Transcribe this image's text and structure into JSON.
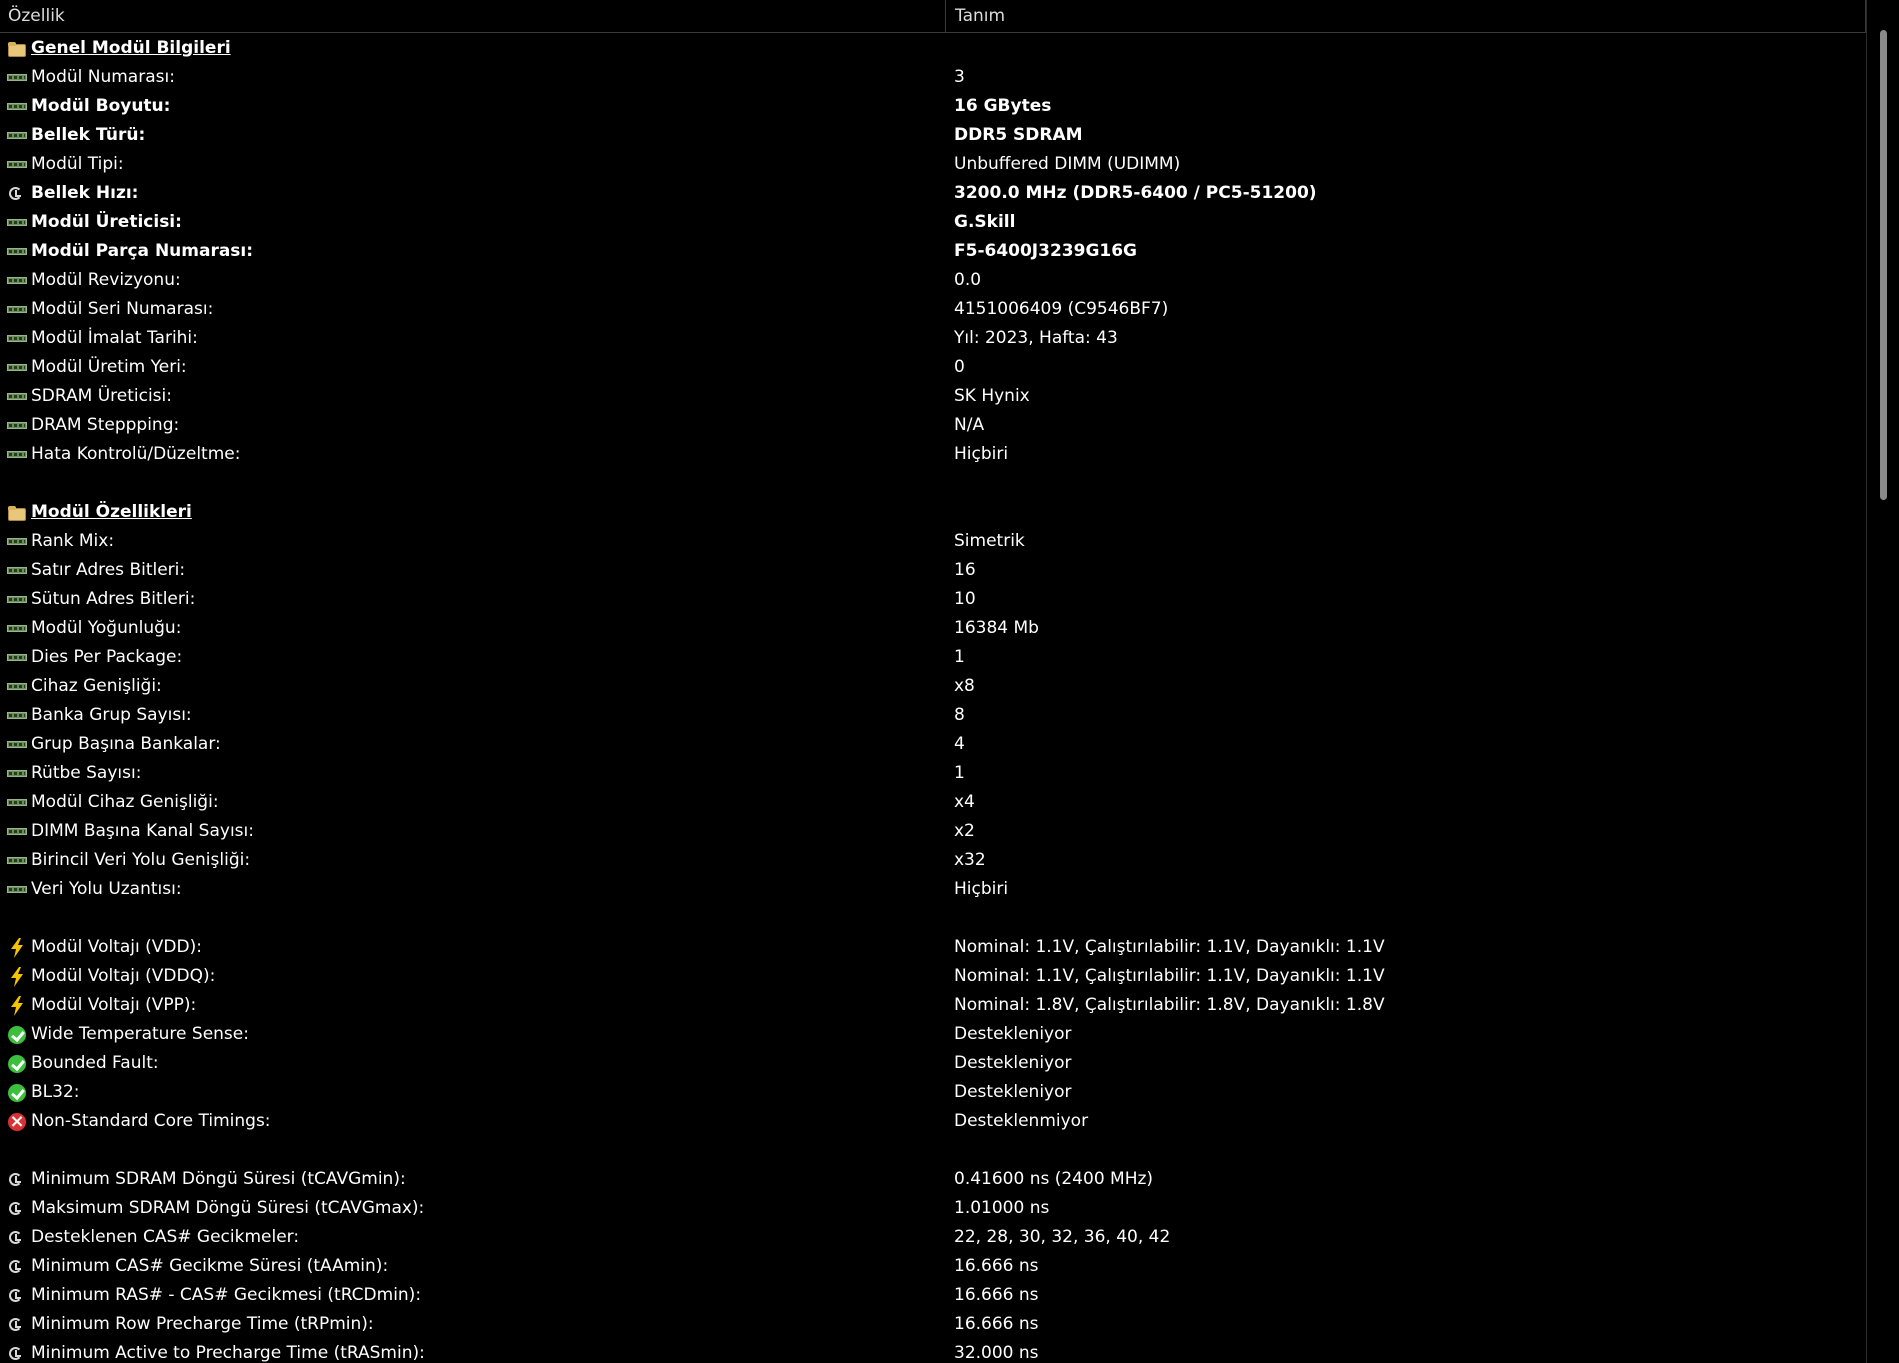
{
  "header": {
    "col1": "Özellik",
    "col2": "Tanım"
  },
  "rows": [
    {
      "type": "section",
      "icon": "folder-icon",
      "label": "Genel Modül Bilgileri",
      "value": ""
    },
    {
      "type": "item",
      "icon": "ram-icon",
      "label": "Modül Numarası:",
      "value": "3",
      "bold": false
    },
    {
      "type": "item",
      "icon": "ram-icon",
      "label": "Modül Boyutu:",
      "value": "16 GBytes",
      "bold": true
    },
    {
      "type": "item",
      "icon": "ram-icon",
      "label": "Bellek Türü:",
      "value": "DDR5 SDRAM",
      "bold": true
    },
    {
      "type": "item",
      "icon": "ram-icon",
      "label": "Modül Tipi:",
      "value": "Unbuffered DIMM (UDIMM)",
      "bold": false
    },
    {
      "type": "item",
      "icon": "clock-icon",
      "label": "Bellek Hızı:",
      "value": "3200.0 MHz (DDR5-6400 / PC5-51200)",
      "bold": true
    },
    {
      "type": "item",
      "icon": "ram-icon",
      "label": "Modül Üreticisi:",
      "value": "G.Skill",
      "bold": true
    },
    {
      "type": "item",
      "icon": "ram-icon",
      "label": "Modül Parça Numarası:",
      "value": "F5-6400J3239G16G",
      "bold": true
    },
    {
      "type": "item",
      "icon": "ram-icon",
      "label": "Modül Revizyonu:",
      "value": "0.0",
      "bold": false
    },
    {
      "type": "item",
      "icon": "ram-icon",
      "label": "Modül Seri Numarası:",
      "value": "4151006409 (C9546BF7)",
      "bold": false
    },
    {
      "type": "item",
      "icon": "ram-icon",
      "label": "Modül İmalat Tarihi:",
      "value": "Yıl: 2023, Hafta: 43",
      "bold": false
    },
    {
      "type": "item",
      "icon": "ram-icon",
      "label": "Modül Üretim Yeri:",
      "value": "0",
      "bold": false
    },
    {
      "type": "item",
      "icon": "ram-icon",
      "label": "SDRAM Üreticisi:",
      "value": "SK Hynix",
      "bold": false
    },
    {
      "type": "item",
      "icon": "ram-icon",
      "label": "DRAM Steppping:",
      "value": "N/A",
      "bold": false
    },
    {
      "type": "item",
      "icon": "ram-icon",
      "label": "Hata Kontrolü/Düzeltme:",
      "value": "Hiçbiri",
      "bold": false
    },
    {
      "type": "blank"
    },
    {
      "type": "section",
      "icon": "folder-icon",
      "label": "Modül Özellikleri",
      "value": ""
    },
    {
      "type": "item",
      "icon": "ram-icon",
      "label": "Rank Mix:",
      "value": "Simetrik",
      "bold": false
    },
    {
      "type": "item",
      "icon": "ram-icon",
      "label": "Satır Adres Bitleri:",
      "value": "16",
      "bold": false
    },
    {
      "type": "item",
      "icon": "ram-icon",
      "label": "Sütun Adres Bitleri:",
      "value": "10",
      "bold": false
    },
    {
      "type": "item",
      "icon": "ram-icon",
      "label": "Modül Yoğunluğu:",
      "value": "16384 Mb",
      "bold": false
    },
    {
      "type": "item",
      "icon": "ram-icon",
      "label": "Dies Per Package:",
      "value": "1",
      "bold": false
    },
    {
      "type": "item",
      "icon": "ram-icon",
      "label": "Cihaz Genişliği:",
      "value": "x8",
      "bold": false
    },
    {
      "type": "item",
      "icon": "ram-icon",
      "label": "Banka Grup Sayısı:",
      "value": "8",
      "bold": false
    },
    {
      "type": "item",
      "icon": "ram-icon",
      "label": "Grup Başına Bankalar:",
      "value": "4",
      "bold": false
    },
    {
      "type": "item",
      "icon": "ram-icon",
      "label": "Rütbe Sayısı:",
      "value": "1",
      "bold": false
    },
    {
      "type": "item",
      "icon": "ram-icon",
      "label": "Modül Cihaz Genişliği:",
      "value": "x4",
      "bold": false
    },
    {
      "type": "item",
      "icon": "ram-icon",
      "label": "DIMM Başına Kanal Sayısı:",
      "value": "x2",
      "bold": false
    },
    {
      "type": "item",
      "icon": "ram-icon",
      "label": "Birincil Veri Yolu Genişliği:",
      "value": "x32",
      "bold": false
    },
    {
      "type": "item",
      "icon": "ram-icon",
      "label": "Veri Yolu Uzantısı:",
      "value": "Hiçbiri",
      "bold": false
    },
    {
      "type": "blank"
    },
    {
      "type": "item",
      "icon": "bolt-icon",
      "label": "Modül Voltajı (VDD):",
      "value": "Nominal: 1.1V, Çalıştırılabilir: 1.1V, Dayanıklı: 1.1V",
      "bold": false
    },
    {
      "type": "item",
      "icon": "bolt-icon",
      "label": "Modül Voltajı (VDDQ):",
      "value": "Nominal: 1.1V, Çalıştırılabilir: 1.1V, Dayanıklı: 1.1V",
      "bold": false
    },
    {
      "type": "item",
      "icon": "bolt-icon",
      "label": "Modül Voltajı (VPP):",
      "value": "Nominal: 1.8V, Çalıştırılabilir: 1.8V, Dayanıklı: 1.8V",
      "bold": false
    },
    {
      "type": "item",
      "icon": "check-icon",
      "label": "Wide Temperature Sense:",
      "value": "Destekleniyor",
      "bold": false
    },
    {
      "type": "item",
      "icon": "check-icon",
      "label": "Bounded Fault:",
      "value": "Destekleniyor",
      "bold": false
    },
    {
      "type": "item",
      "icon": "check-icon",
      "label": "BL32:",
      "value": "Destekleniyor",
      "bold": false
    },
    {
      "type": "item",
      "icon": "cross-icon",
      "label": "Non-Standard Core Timings:",
      "value": "Desteklenmiyor",
      "bold": false
    },
    {
      "type": "blank"
    },
    {
      "type": "item",
      "icon": "clock-icon",
      "label": "Minimum SDRAM Döngü Süresi (tCAVGmin):",
      "value": "0.41600 ns (2400 MHz)",
      "bold": false
    },
    {
      "type": "item",
      "icon": "clock-icon",
      "label": "Maksimum SDRAM Döngü Süresi (tCAVGmax):",
      "value": "1.01000 ns",
      "bold": false
    },
    {
      "type": "item",
      "icon": "clock-icon",
      "label": "Desteklenen CAS# Gecikmeler:",
      "value": "22, 28, 30, 32, 36, 40, 42",
      "bold": false
    },
    {
      "type": "item",
      "icon": "clock-icon",
      "label": "Minimum CAS# Gecikme Süresi (tAAmin):",
      "value": "16.666 ns",
      "bold": false
    },
    {
      "type": "item",
      "icon": "clock-icon",
      "label": "Minimum RAS# - CAS# Gecikmesi (tRCDmin):",
      "value": "16.666 ns",
      "bold": false
    },
    {
      "type": "item",
      "icon": "clock-icon",
      "label": "Minimum Row Precharge Time (tRPmin):",
      "value": "16.666 ns",
      "bold": false
    },
    {
      "type": "item",
      "icon": "clock-icon",
      "label": "Minimum Active to Precharge Time (tRASmin):",
      "value": "32.000 ns",
      "bold": false
    }
  ],
  "colors": {
    "background": "#000000",
    "text": "#ffffff",
    "bolt": "#f5c400",
    "check": "#3cbf3c",
    "cross": "#d83232"
  }
}
